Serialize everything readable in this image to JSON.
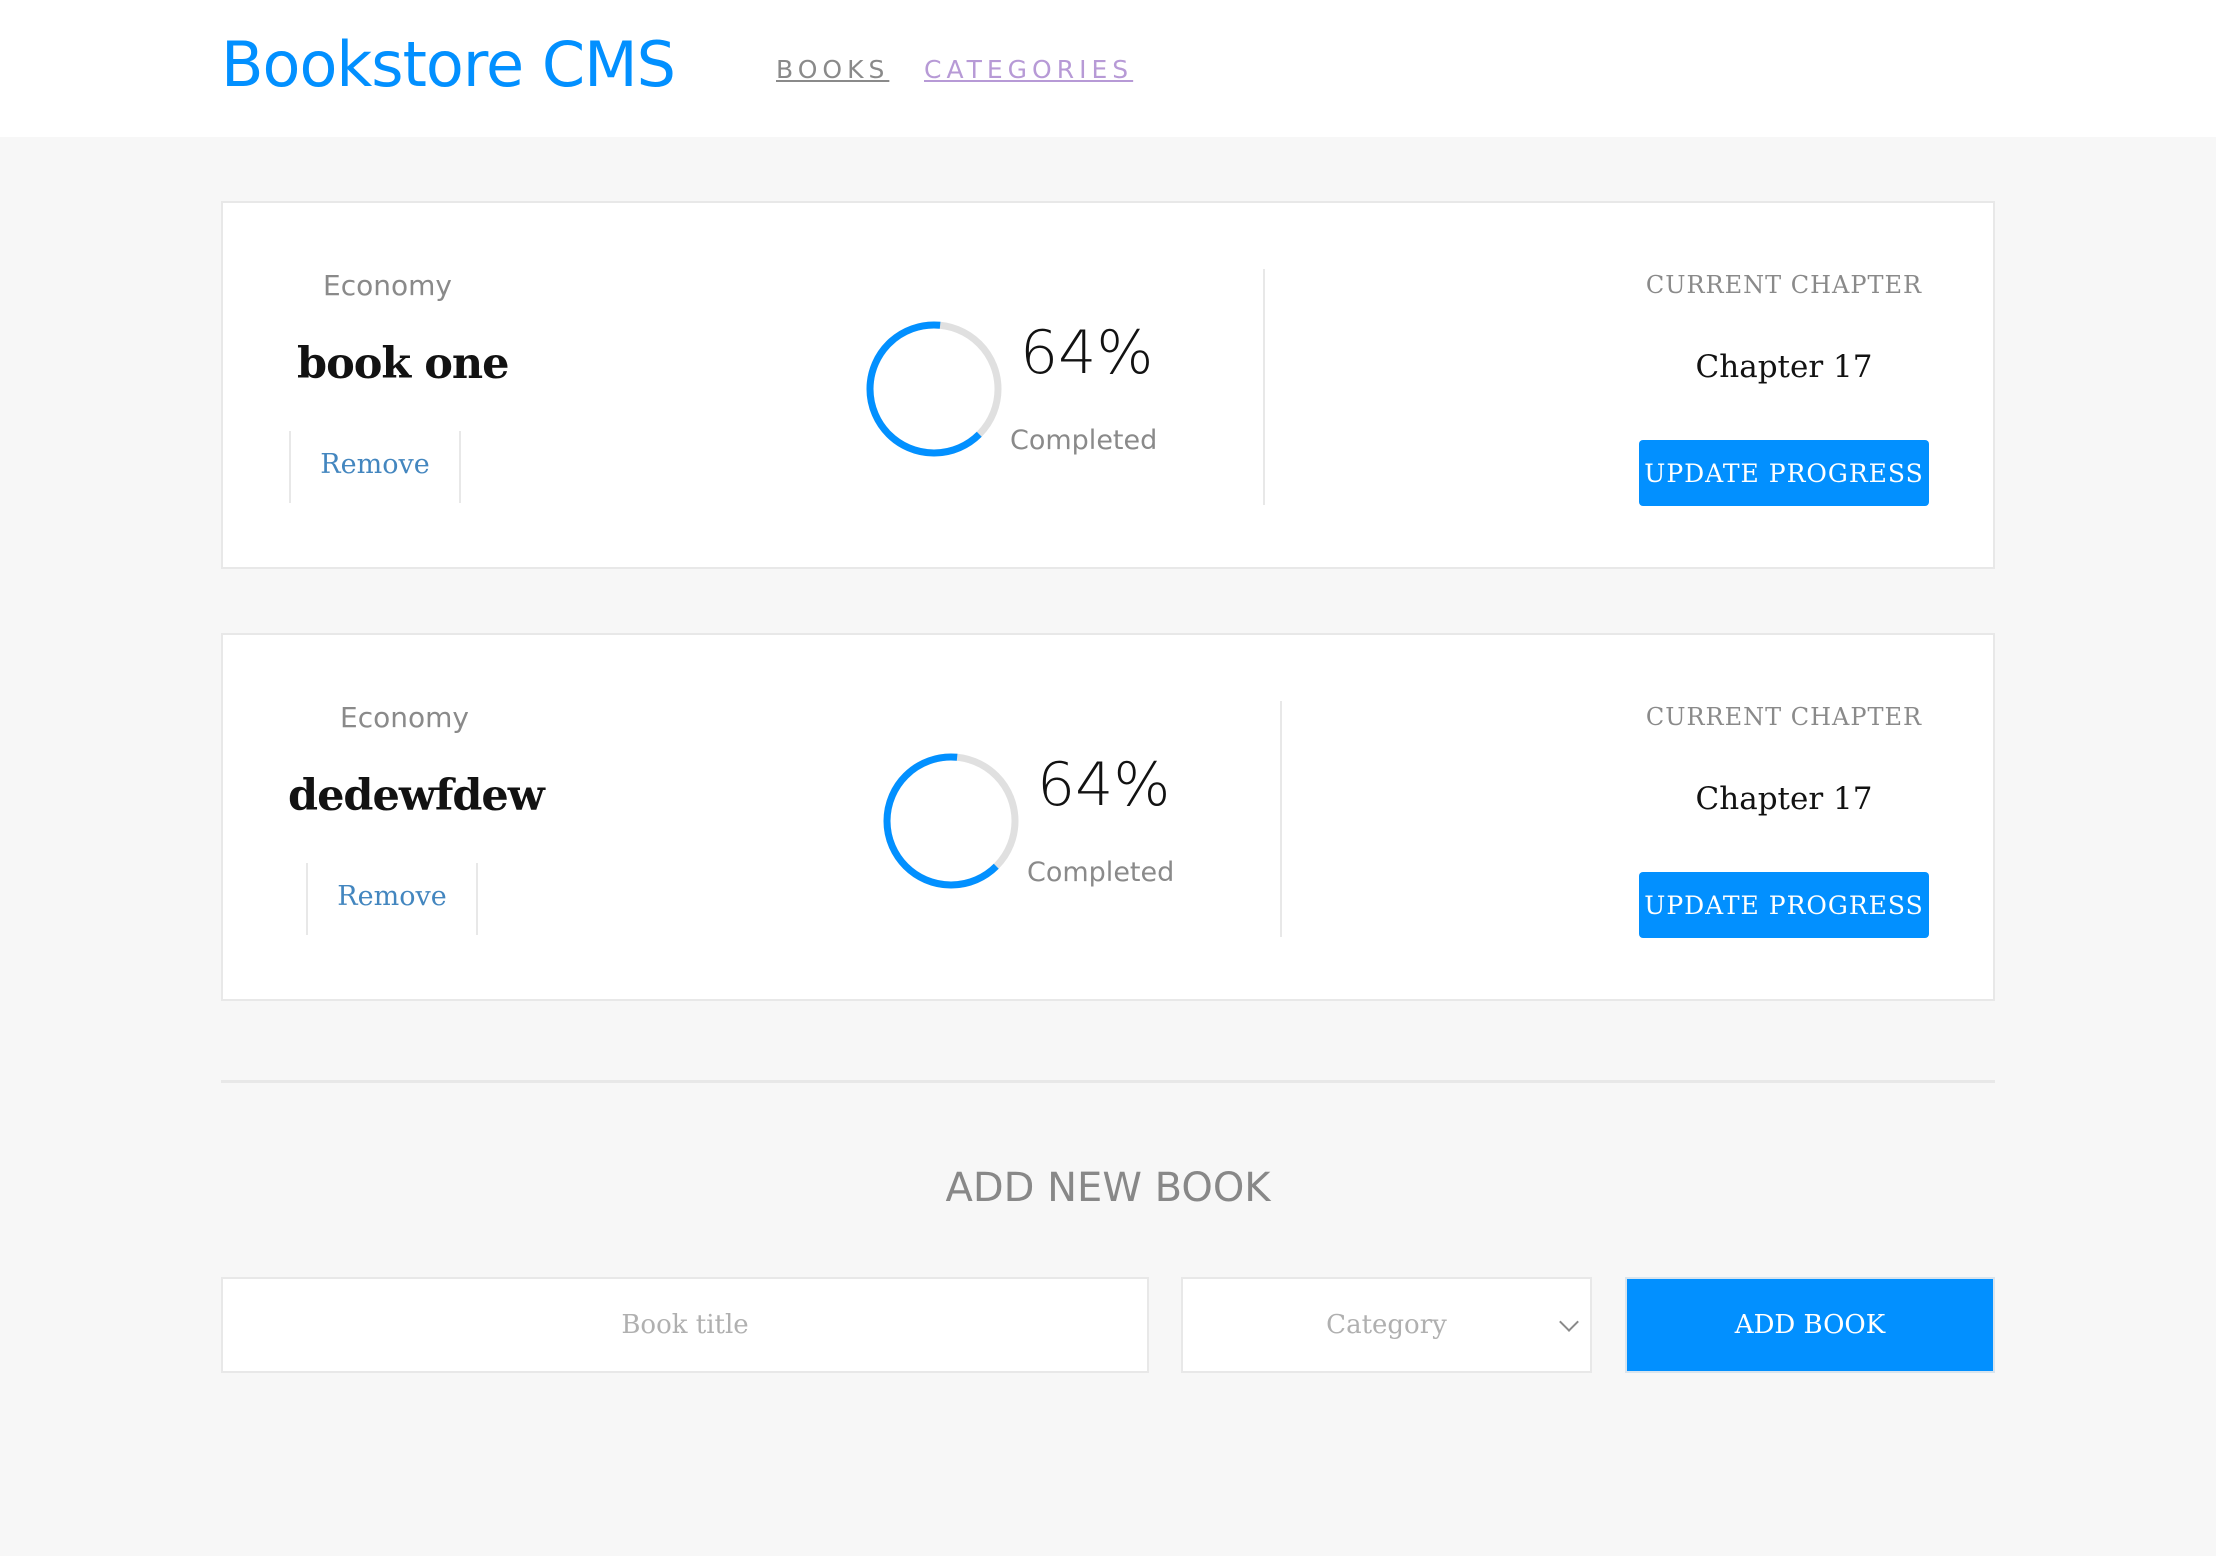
{
  "header": {
    "logo": "Bookstore CMS",
    "nav": [
      "BOOKS",
      "CATEGORIES"
    ]
  },
  "books": [
    {
      "genre": "Economy",
      "title": "book one",
      "remove_label": "Remove",
      "progress_percent": 64,
      "percent_label": "64%",
      "completed_label": "Completed",
      "chapter_label": "CURRENT CHAPTER",
      "chapter": "Chapter 17",
      "update_label": "UPDATE PROGRESS"
    },
    {
      "genre": "Economy",
      "title": "dedewfdew",
      "remove_label": "Remove",
      "progress_percent": 64,
      "percent_label": "64%",
      "completed_label": "Completed",
      "chapter_label": "CURRENT CHAPTER",
      "chapter": "Chapter 17",
      "update_label": "UPDATE PROGRESS"
    }
  ],
  "form": {
    "title": "ADD NEW BOOK",
    "title_placeholder": "Book title",
    "category_placeholder": "Category",
    "submit_label": "ADD BOOK"
  },
  "colors": {
    "accent": "#0290ff",
    "ring_track": "#e0e0e0",
    "link": "#4386bf"
  }
}
